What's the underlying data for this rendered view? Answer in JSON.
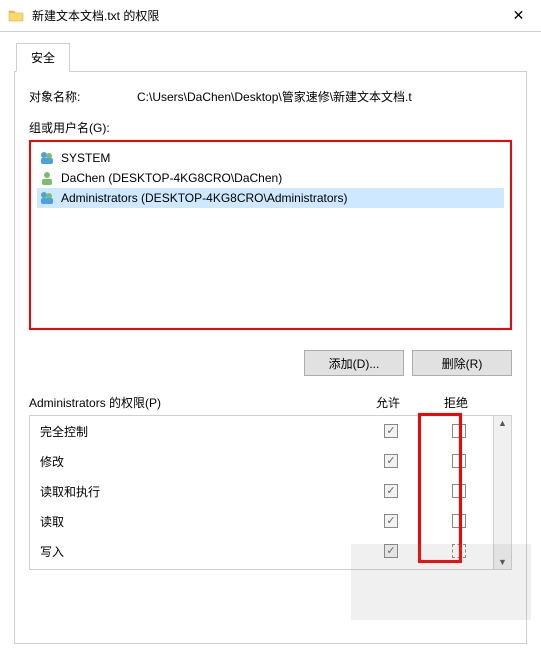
{
  "window": {
    "title": "新建文本文档.txt 的权限",
    "close_label": "✕"
  },
  "tabs": {
    "security": "安全"
  },
  "object": {
    "label": "对象名称:",
    "value": "C:\\Users\\DaChen\\Desktop\\管家速修\\新建文本文档.t"
  },
  "groups": {
    "label": "组或用户名(G):",
    "items": [
      {
        "name": "SYSTEM",
        "type": "group",
        "selected": false
      },
      {
        "name": "DaChen (DESKTOP-4KG8CRO\\DaChen)",
        "type": "user",
        "selected": false
      },
      {
        "name": "Administrators (DESKTOP-4KG8CRO\\Administrators)",
        "type": "group",
        "selected": true
      }
    ]
  },
  "buttons": {
    "add": "添加(D)...",
    "remove": "删除(R)"
  },
  "permissions": {
    "title": "Administrators 的权限(P)",
    "col_allow": "允许",
    "col_deny": "拒绝",
    "rows": [
      {
        "label": "完全控制",
        "allow": true,
        "deny": false
      },
      {
        "label": "修改",
        "allow": true,
        "deny": false
      },
      {
        "label": "读取和执行",
        "allow": true,
        "deny": false
      },
      {
        "label": "读取",
        "allow": true,
        "deny": false
      },
      {
        "label": "写入",
        "allow": true,
        "deny": false,
        "deny_dashed": true
      }
    ]
  },
  "highlight": {
    "deny_column": true
  }
}
